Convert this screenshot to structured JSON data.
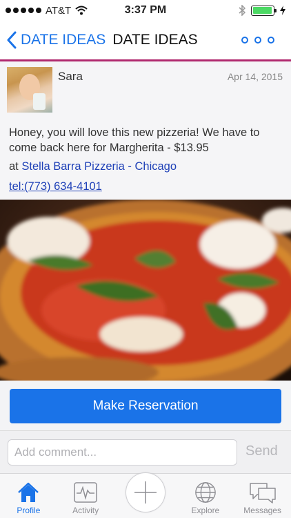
{
  "status_bar": {
    "carrier": "AT&T",
    "time": "3:37 PM",
    "battery_level": 0.95
  },
  "nav": {
    "back_label": "DATE IDEAS",
    "title": "DATE IDEAS"
  },
  "post": {
    "user_name": "Sara",
    "date": "Apr 14, 2015",
    "text": "Honey, you will love this new pizzeria! We have to come back here for Margherita - $13.95",
    "location_prefix": "at ",
    "location_name": "Stella Barra Pizzeria - Chicago",
    "phone": "tel:(773) 634-4101"
  },
  "reservation": {
    "button_label": "Make Reservation"
  },
  "comment": {
    "placeholder": "Add comment...",
    "send_label": "Send"
  },
  "tabs": [
    {
      "label": "Profile",
      "icon": "home-icon",
      "active": true
    },
    {
      "label": "Activity",
      "icon": "activity-icon",
      "active": false
    },
    {
      "label": "",
      "icon": "add-icon",
      "active": false
    },
    {
      "label": "Explore",
      "icon": "globe-icon",
      "active": false
    },
    {
      "label": "Messages",
      "icon": "messages-icon",
      "active": false
    }
  ],
  "colors": {
    "accent": "#1a73e8",
    "divider": "#b0286e",
    "link": "#1e40b7"
  }
}
